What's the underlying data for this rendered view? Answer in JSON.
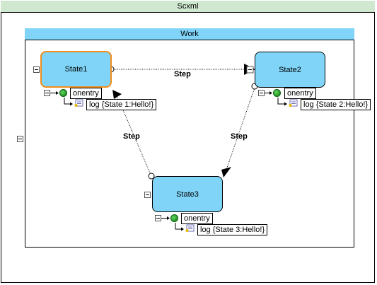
{
  "outer": {
    "title": "Scxml"
  },
  "work": {
    "title": "Work"
  },
  "states": {
    "state1": {
      "name": "State1",
      "onentry": "onentry",
      "log": "log {State 1:Hello!}"
    },
    "state2": {
      "name": "State2",
      "onentry": "onentry",
      "log": "log {State 2:Hello!}"
    },
    "state3": {
      "name": "State3",
      "onentry": "onentry",
      "log": "log {State 3:Hello!}"
    }
  },
  "transitions": [
    {
      "from": "State1",
      "to": "State2",
      "label": "Step"
    },
    {
      "from": "State2",
      "to": "State3",
      "label": "Step"
    },
    {
      "from": "State3",
      "to": "State1",
      "label": "Step"
    }
  ],
  "colors": {
    "state_fill": "#7fd4f8",
    "selected_border": "#f28c1a",
    "outer_header": "#cfe8cf"
  }
}
